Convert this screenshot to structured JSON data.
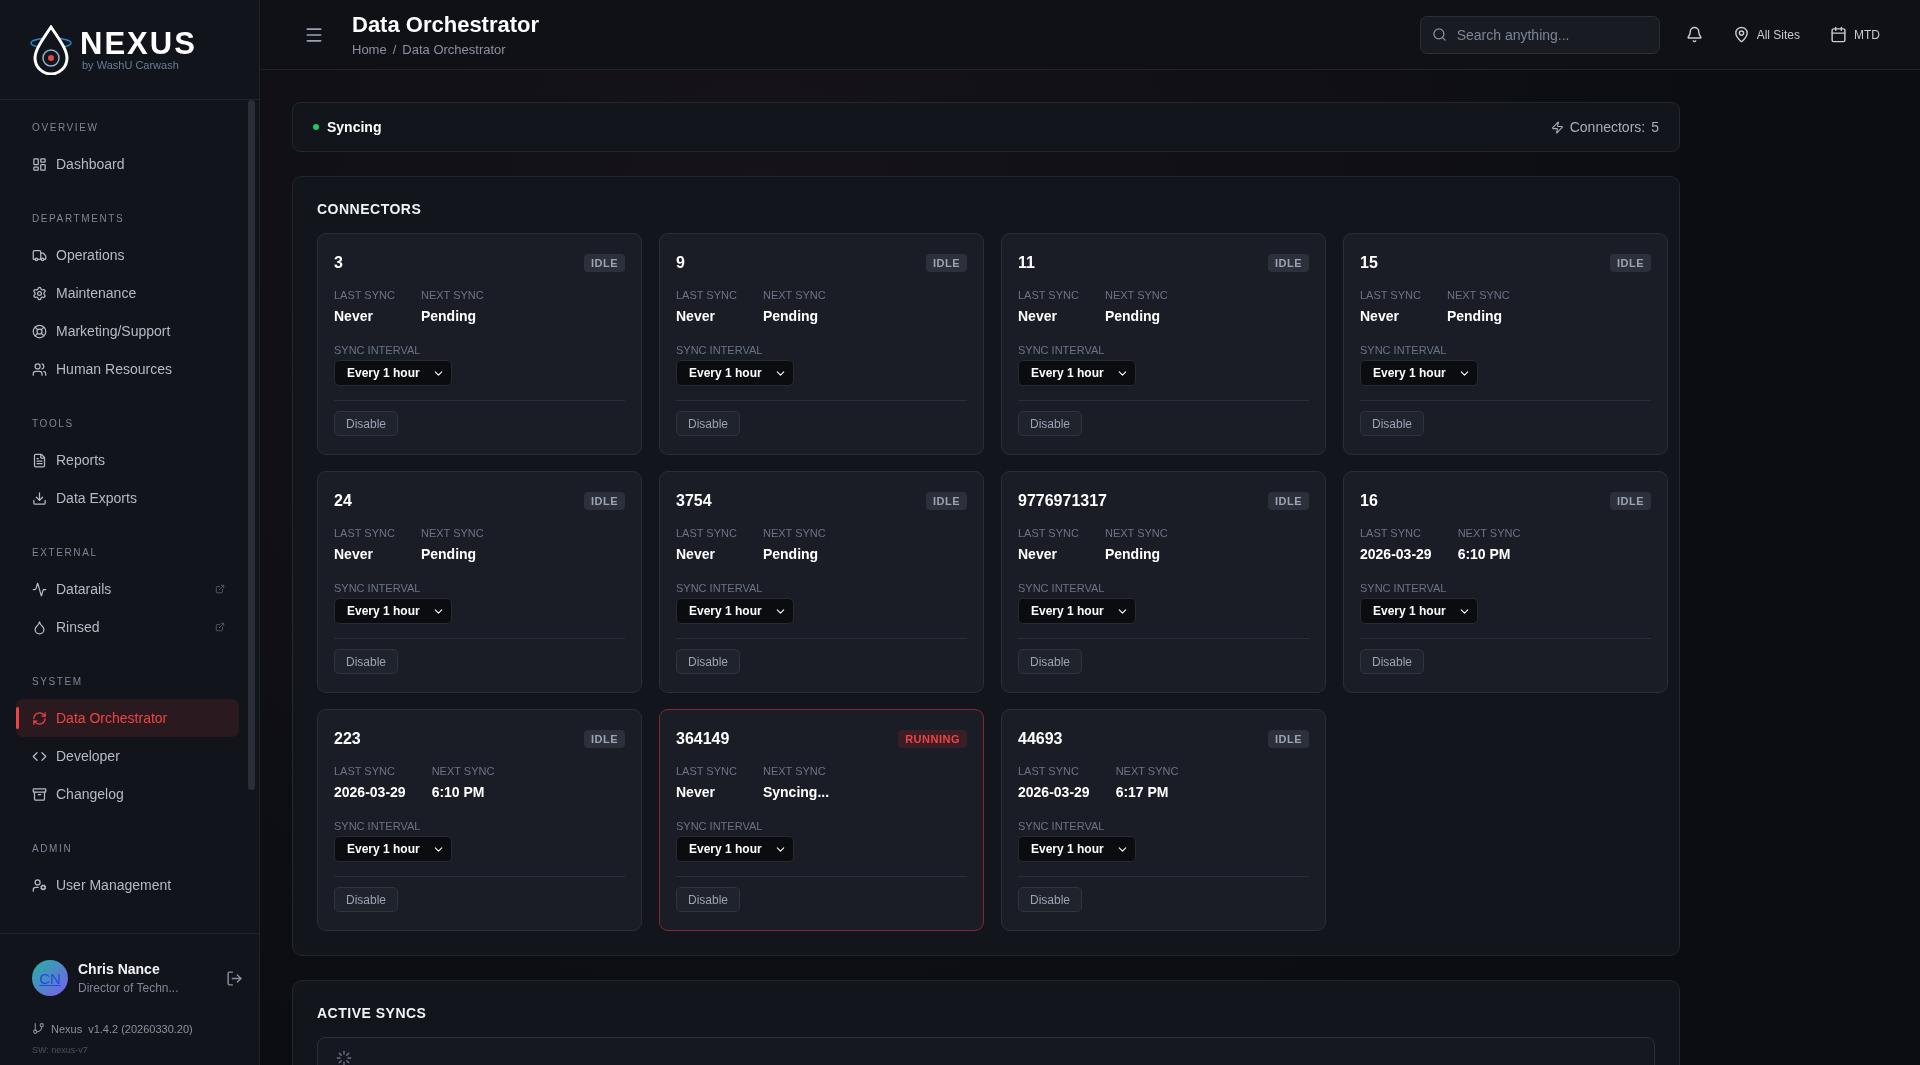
{
  "sidebar": {
    "logo": {
      "title": "NEXUS",
      "subtitle": "by WashU Carwash"
    },
    "sections": [
      {
        "title": "OVERVIEW",
        "items": [
          {
            "label": "Dashboard",
            "external": false,
            "selected": false
          }
        ]
      },
      {
        "title": "DEPARTMENTS",
        "items": [
          {
            "label": "Operations",
            "external": false,
            "selected": false
          },
          {
            "label": "Maintenance",
            "external": false,
            "selected": false
          },
          {
            "label": "Marketing/Support",
            "external": false,
            "selected": false
          },
          {
            "label": "Human Resources",
            "external": false,
            "selected": false
          }
        ]
      },
      {
        "title": "TOOLS",
        "items": [
          {
            "label": "Reports",
            "external": false,
            "selected": false
          },
          {
            "label": "Data Exports",
            "external": false,
            "selected": false
          }
        ]
      },
      {
        "title": "EXTERNAL",
        "items": [
          {
            "label": "Datarails",
            "external": true,
            "selected": false
          },
          {
            "label": "Rinsed",
            "external": true,
            "selected": false
          }
        ]
      },
      {
        "title": "SYSTEM",
        "items": [
          {
            "label": "Data Orchestrator",
            "external": false,
            "selected": true
          },
          {
            "label": "Developer",
            "external": false,
            "selected": false
          },
          {
            "label": "Changelog",
            "external": false,
            "selected": false
          }
        ]
      },
      {
        "title": "ADMIN",
        "items": [
          {
            "label": "User Management",
            "external": false,
            "selected": false
          }
        ]
      }
    ],
    "user": {
      "initials": "CN",
      "name": "Chris Nance",
      "role": "Director of Techn..."
    },
    "version": {
      "app": "Nexus",
      "number": "v1.4.2 (20260330.20)",
      "sw": "SW: nexus-v7"
    }
  },
  "header": {
    "title": "Data Orchestrator",
    "breadcrumb": [
      "Home",
      "Data Orchestrator"
    ],
    "breadcrumb_separator": "/",
    "search": {
      "placeholder": "Search anything..."
    },
    "site": "All Sites",
    "period": "MTD"
  },
  "status": {
    "label": "Syncing",
    "connectors_label": "Connectors:",
    "connectors_count": "5"
  },
  "connectors": {
    "title": "CONNECTORS",
    "items": [
      {
        "name": "3",
        "kind": "idle",
        "badge": "IDLE",
        "last_label": "LAST SYNC",
        "last": "Never",
        "next_label": "NEXT SYNC",
        "next": "Pending",
        "interval_label": "SYNC INTERVAL",
        "interval": "Every 1 hour",
        "action": "Disable"
      },
      {
        "name": "9",
        "kind": "idle",
        "badge": "IDLE",
        "last_label": "LAST SYNC",
        "last": "Never",
        "next_label": "NEXT SYNC",
        "next": "Pending",
        "interval_label": "SYNC INTERVAL",
        "interval": "Every 1 hour",
        "action": "Disable"
      },
      {
        "name": "11",
        "kind": "idle",
        "badge": "IDLE",
        "last_label": "LAST SYNC",
        "last": "Never",
        "next_label": "NEXT SYNC",
        "next": "Pending",
        "interval_label": "SYNC INTERVAL",
        "interval": "Every 1 hour",
        "action": "Disable"
      },
      {
        "name": "15",
        "kind": "idle",
        "badge": "IDLE",
        "last_label": "LAST SYNC",
        "last": "Never",
        "next_label": "NEXT SYNC",
        "next": "Pending",
        "interval_label": "SYNC INTERVAL",
        "interval": "Every 1 hour",
        "action": "Disable"
      },
      {
        "name": "24",
        "kind": "idle",
        "badge": "IDLE",
        "last_label": "LAST SYNC",
        "last": "Never",
        "next_label": "NEXT SYNC",
        "next": "Pending",
        "interval_label": "SYNC INTERVAL",
        "interval": "Every 1 hour",
        "action": "Disable"
      },
      {
        "name": "3754",
        "kind": "idle",
        "badge": "IDLE",
        "last_label": "LAST SYNC",
        "last": "Never",
        "next_label": "NEXT SYNC",
        "next": "Pending",
        "interval_label": "SYNC INTERVAL",
        "interval": "Every 1 hour",
        "action": "Disable"
      },
      {
        "name": "9776971317",
        "kind": "idle",
        "badge": "IDLE",
        "last_label": "LAST SYNC",
        "last": "Never",
        "next_label": "NEXT SYNC",
        "next": "Pending",
        "interval_label": "SYNC INTERVAL",
        "interval": "Every 1 hour",
        "action": "Disable"
      },
      {
        "name": "16",
        "kind": "idle",
        "badge": "IDLE",
        "last_label": "LAST SYNC",
        "last": "2026-03-29",
        "next_label": "NEXT SYNC",
        "next": "6:10 PM",
        "interval_label": "SYNC INTERVAL",
        "interval": "Every 1 hour",
        "action": "Disable"
      },
      {
        "name": "223",
        "kind": "idle",
        "badge": "IDLE",
        "last_label": "LAST SYNC",
        "last": "2026-03-29",
        "next_label": "NEXT SYNC",
        "next": "6:10 PM",
        "interval_label": "SYNC INTERVAL",
        "interval": "Every 1 hour",
        "action": "Disable"
      },
      {
        "name": "364149",
        "kind": "running",
        "badge": "RUNNING",
        "last_label": "LAST SYNC",
        "last": "Never",
        "next_label": "NEXT SYNC",
        "next": "Syncing...",
        "interval_label": "SYNC INTERVAL",
        "interval": "Every 1 hour",
        "action": "Disable"
      },
      {
        "name": "44693",
        "kind": "idle",
        "badge": "IDLE",
        "last_label": "LAST SYNC",
        "last": "2026-03-29",
        "next_label": "NEXT SYNC",
        "next": "6:17 PM",
        "interval_label": "SYNC INTERVAL",
        "interval": "Every 1 hour",
        "action": "Disable"
      }
    ]
  },
  "active_syncs": {
    "title": "ACTIVE SYNCS"
  }
}
